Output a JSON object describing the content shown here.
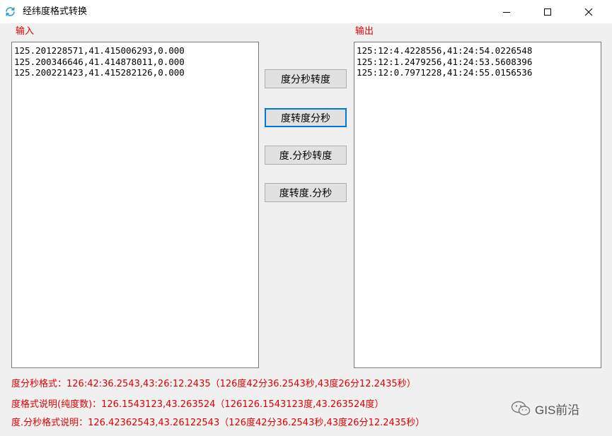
{
  "window": {
    "title": "经纬度格式转换",
    "controls": [
      "minimize",
      "maximize",
      "close"
    ]
  },
  "input": {
    "label": "输入",
    "lines": [
      "125.201228571,41.415006293,0.000",
      "125.200346646,41.414878011,0.000",
      "125.200221423,41.415282126,0.000"
    ]
  },
  "output": {
    "label": "输出",
    "lines": [
      "125:12:4.4228556,41:24:54.0226548",
      "125:12:1.2479256,41:24:53.5608396",
      "125:12:0.7971228,41:24:55.0156536"
    ]
  },
  "buttons": {
    "dms_to_deg": "度分秒转度",
    "deg_to_dms": "度转度分秒",
    "dot_dms_to_deg": "度.分秒转度",
    "deg_to_dot_dms": "度转度.分秒"
  },
  "notes": {
    "dms_format": "度分秒格式：126:42:36.2543,43:26:12.2435（126度42分36.2543秒,43度26分12.2435秒）",
    "deg_format": "度格式说明(纯度数)：126.1543123,43.263524（126126.1543123度,43.263524度）",
    "dot_dms_format": "度.分秒格式说明：126.42362543,43.26122543（126度42分36.2543秒,43度26分12.2435秒）"
  },
  "watermark": {
    "text": "GIS前沿",
    "icon": "wechat-icon"
  },
  "colors": {
    "label_red": "#e00000",
    "focus_blue": "#0078d7",
    "button_face": "#e1e1e1"
  }
}
